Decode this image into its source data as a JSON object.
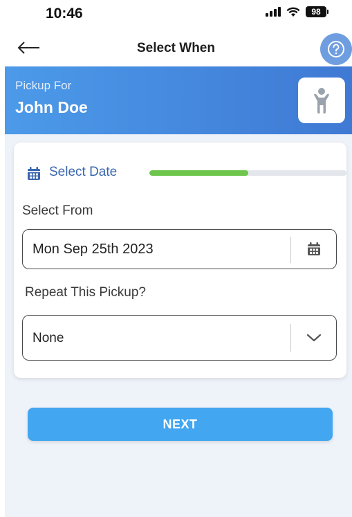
{
  "status_bar": {
    "time": "10:46",
    "battery": "98",
    "icons": [
      "cellular-signal-icon",
      "wifi-icon",
      "battery-icon"
    ]
  },
  "nav": {
    "title": "Select When",
    "back_icon": "arrow-left-icon",
    "help_icon": "question-circle-icon"
  },
  "banner": {
    "label": "Pickup For",
    "name": "John Doe",
    "avatar_icon": "child-figure-icon"
  },
  "card": {
    "step_label": "Select Date",
    "step_icon": "calendar-icon",
    "progress_fraction": 0.5,
    "select_from": {
      "label": "Select From",
      "value": "Mon Sep 25th 2023",
      "icon": "calendar-icon"
    },
    "repeat": {
      "label": "Repeat This Pickup?",
      "selected": "None",
      "icon": "chevron-down-icon"
    }
  },
  "next_button": {
    "label": "NEXT"
  },
  "colors": {
    "primary_blue": "#42a6f0",
    "banner_start": "#4c9ae9",
    "banner_end": "#3f79d4",
    "progress_green": "#6dc54c",
    "step_text": "#3a66ad"
  }
}
